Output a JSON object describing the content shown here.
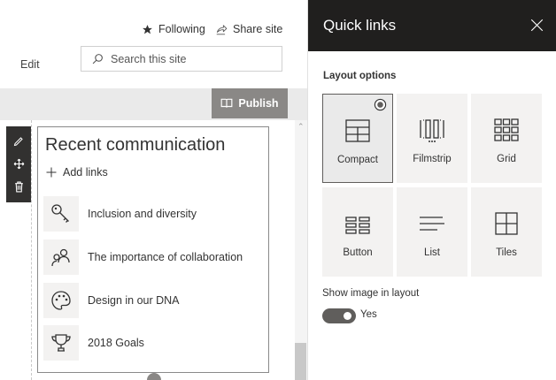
{
  "header": {
    "following_label": "Following",
    "share_label": "Share site",
    "edit_label": "Edit",
    "search_placeholder": "Search this site"
  },
  "edit_bar": {
    "publish_label": "Publish"
  },
  "webpart": {
    "title": "Recent communication",
    "add_links_label": "Add links",
    "links": [
      {
        "label": "Inclusion and diversity",
        "icon": "key-icon"
      },
      {
        "label": "The importance of collaboration",
        "icon": "people-icon"
      },
      {
        "label": "Design in our DNA",
        "icon": "palette-icon"
      },
      {
        "label": "2018 Goals",
        "icon": "trophy-icon"
      }
    ]
  },
  "panel": {
    "title": "Quick links",
    "section_label": "Layout options",
    "layouts": [
      {
        "label": "Compact",
        "selected": true
      },
      {
        "label": "Filmstrip",
        "selected": false
      },
      {
        "label": "Grid",
        "selected": false
      },
      {
        "label": "Button",
        "selected": false
      },
      {
        "label": "List",
        "selected": false
      },
      {
        "label": "Tiles",
        "selected": false
      }
    ],
    "toggle": {
      "label": "Show image in layout",
      "value_label": "Yes",
      "on": true
    }
  },
  "colors": {
    "panel_header_bg": "#201f1e",
    "publish_bg": "#8a8886",
    "toolbar_bg": "#323130",
    "tile_bg": "#f3f2f1"
  }
}
